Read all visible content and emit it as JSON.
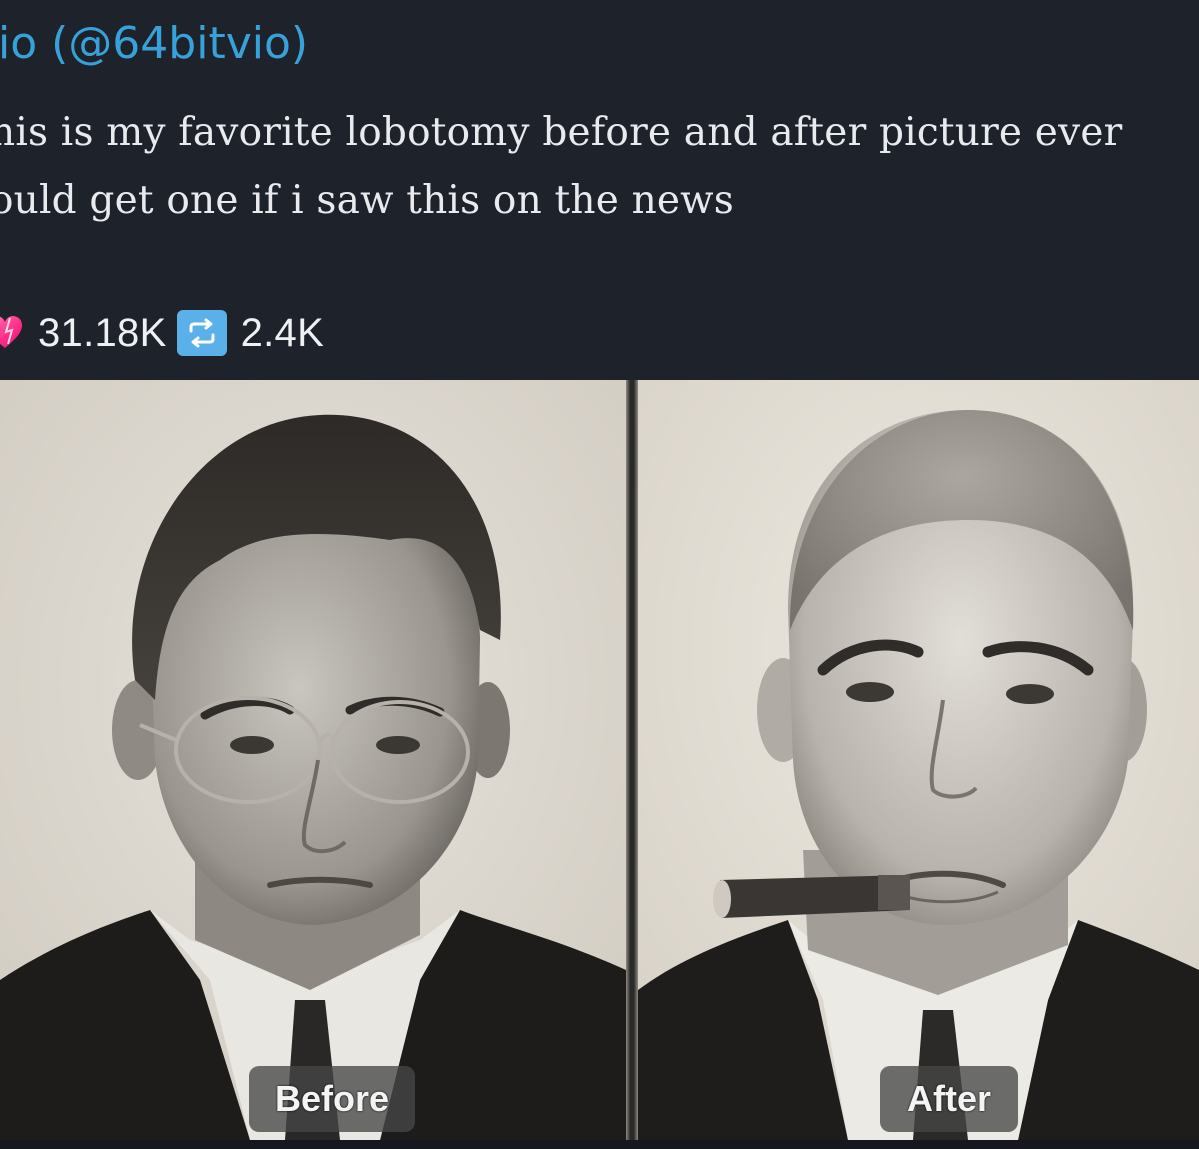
{
  "post": {
    "author": "io (@64bitvio)",
    "text_line_1": "his is my favorite lobotomy before and after picture ever",
    "text_line_2": "ould get one if i saw this on the news",
    "likes": "31.18K",
    "reposts": "2.4K"
  },
  "icons": {
    "likes_icon": "heart-icon",
    "reposts_icon": "repost-icon"
  },
  "image": {
    "before_label": "Before",
    "after_label": "After"
  },
  "colors": {
    "background": "#1e222b",
    "author": "#37a2d9",
    "text": "#e8eaee",
    "heart": "#ff3f8f",
    "repost": "#5ab0e8"
  }
}
